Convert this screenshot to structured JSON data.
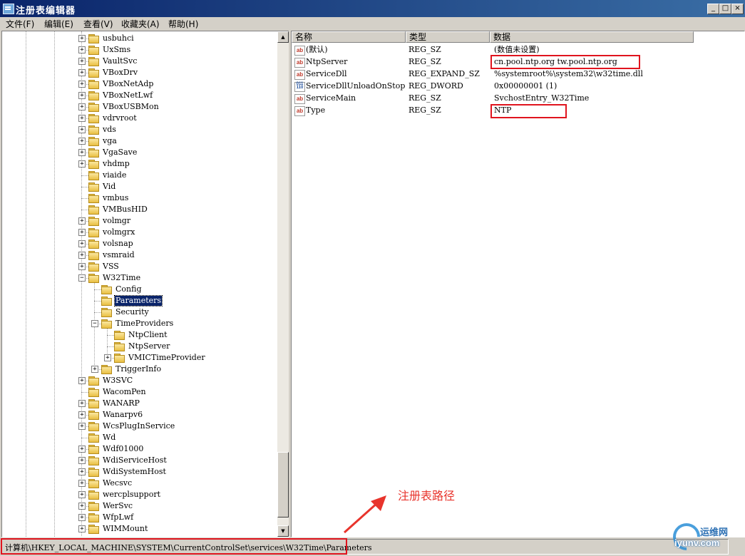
{
  "window": {
    "title": "注册表编辑器",
    "minimize": "_",
    "restore": "□",
    "close": "×"
  },
  "menu": [
    "文件(F)",
    "编辑(E)",
    "查看(V)",
    "收藏夹(A)",
    "帮助(H)"
  ],
  "tree": {
    "nodes": [
      {
        "label": "usbuhci",
        "depth": 0,
        "expander": "+"
      },
      {
        "label": "UxSms",
        "depth": 0,
        "expander": "+"
      },
      {
        "label": "VaultSvc",
        "depth": 0,
        "expander": "+"
      },
      {
        "label": "VBoxDrv",
        "depth": 0,
        "expander": "+"
      },
      {
        "label": "VBoxNetAdp",
        "depth": 0,
        "expander": "+"
      },
      {
        "label": "VBoxNetLwf",
        "depth": 0,
        "expander": "+"
      },
      {
        "label": "VBoxUSBMon",
        "depth": 0,
        "expander": "+"
      },
      {
        "label": "vdrvroot",
        "depth": 0,
        "expander": "+"
      },
      {
        "label": "vds",
        "depth": 0,
        "expander": "+"
      },
      {
        "label": "vga",
        "depth": 0,
        "expander": "+"
      },
      {
        "label": "VgaSave",
        "depth": 0,
        "expander": "+"
      },
      {
        "label": "vhdmp",
        "depth": 0,
        "expander": "+"
      },
      {
        "label": "viaide",
        "depth": 0,
        "expander": ""
      },
      {
        "label": "Vid",
        "depth": 0,
        "expander": ""
      },
      {
        "label": "vmbus",
        "depth": 0,
        "expander": ""
      },
      {
        "label": "VMBusHID",
        "depth": 0,
        "expander": ""
      },
      {
        "label": "volmgr",
        "depth": 0,
        "expander": "+"
      },
      {
        "label": "volmgrx",
        "depth": 0,
        "expander": "+"
      },
      {
        "label": "volsnap",
        "depth": 0,
        "expander": "+"
      },
      {
        "label": "vsmraid",
        "depth": 0,
        "expander": "+"
      },
      {
        "label": "VSS",
        "depth": 0,
        "expander": "+"
      },
      {
        "label": "W32Time",
        "depth": 0,
        "expander": "-"
      },
      {
        "label": "Config",
        "depth": 1,
        "expander": ""
      },
      {
        "label": "Parameters",
        "depth": 1,
        "expander": "",
        "selected": true
      },
      {
        "label": "Security",
        "depth": 1,
        "expander": ""
      },
      {
        "label": "TimeProviders",
        "depth": 1,
        "expander": "-"
      },
      {
        "label": "NtpClient",
        "depth": 2,
        "expander": ""
      },
      {
        "label": "NtpServer",
        "depth": 2,
        "expander": ""
      },
      {
        "label": "VMICTimeProvider",
        "depth": 2,
        "expander": "+"
      },
      {
        "label": "TriggerInfo",
        "depth": 1,
        "expander": "+"
      },
      {
        "label": "W3SVC",
        "depth": 0,
        "expander": "+"
      },
      {
        "label": "WacomPen",
        "depth": 0,
        "expander": ""
      },
      {
        "label": "WANARP",
        "depth": 0,
        "expander": "+"
      },
      {
        "label": "Wanarpv6",
        "depth": 0,
        "expander": "+"
      },
      {
        "label": "WcsPlugInService",
        "depth": 0,
        "expander": "+"
      },
      {
        "label": "Wd",
        "depth": 0,
        "expander": ""
      },
      {
        "label": "Wdf01000",
        "depth": 0,
        "expander": "+"
      },
      {
        "label": "WdiServiceHost",
        "depth": 0,
        "expander": "+"
      },
      {
        "label": "WdiSystemHost",
        "depth": 0,
        "expander": "+"
      },
      {
        "label": "Wecsvc",
        "depth": 0,
        "expander": "+"
      },
      {
        "label": "wercplsupport",
        "depth": 0,
        "expander": "+"
      },
      {
        "label": "WerSvc",
        "depth": 0,
        "expander": "+"
      },
      {
        "label": "WfpLwf",
        "depth": 0,
        "expander": "+"
      },
      {
        "label": "WIMMount",
        "depth": 0,
        "expander": "+"
      }
    ]
  },
  "values": {
    "headers": {
      "name": "名称",
      "type": "类型",
      "data": "数据"
    },
    "rows": [
      {
        "icon": "string-value-icon",
        "badge": "ab",
        "name": "(默认)",
        "type": "REG_SZ",
        "data": "(数值未设置)"
      },
      {
        "icon": "string-value-icon",
        "badge": "ab",
        "name": "NtpServer",
        "type": "REG_SZ",
        "data": "cn.pool.ntp.org tw.pool.ntp.org"
      },
      {
        "icon": "string-value-icon",
        "badge": "ab",
        "name": "ServiceDll",
        "type": "REG_EXPAND_SZ",
        "data": "%systemroot%\\system32\\w32time.dll"
      },
      {
        "icon": "binary-value-icon",
        "badge": "011 110",
        "name": "ServiceDllUnloadOnStop",
        "type": "REG_DWORD",
        "data": "0x00000001 (1)"
      },
      {
        "icon": "string-value-icon",
        "badge": "ab",
        "name": "ServiceMain",
        "type": "REG_SZ",
        "data": "SvchostEntry_W32Time"
      },
      {
        "icon": "string-value-icon",
        "badge": "ab",
        "name": "Type",
        "type": "REG_SZ",
        "data": "NTP"
      }
    ]
  },
  "statusbar": {
    "path": "计算机\\HKEY_LOCAL_MACHINE\\SYSTEM\\CurrentControlSet\\services\\W32Time\\Parameters"
  },
  "annotation": {
    "text": "注册表路径",
    "color": "#e8342c"
  },
  "watermark": {
    "line1": "运维网",
    "line2": "iyunv.com"
  },
  "colors": {
    "selection": "#0a246a",
    "highlight_box": "#e0141e",
    "titlebar": "#0a246a"
  }
}
